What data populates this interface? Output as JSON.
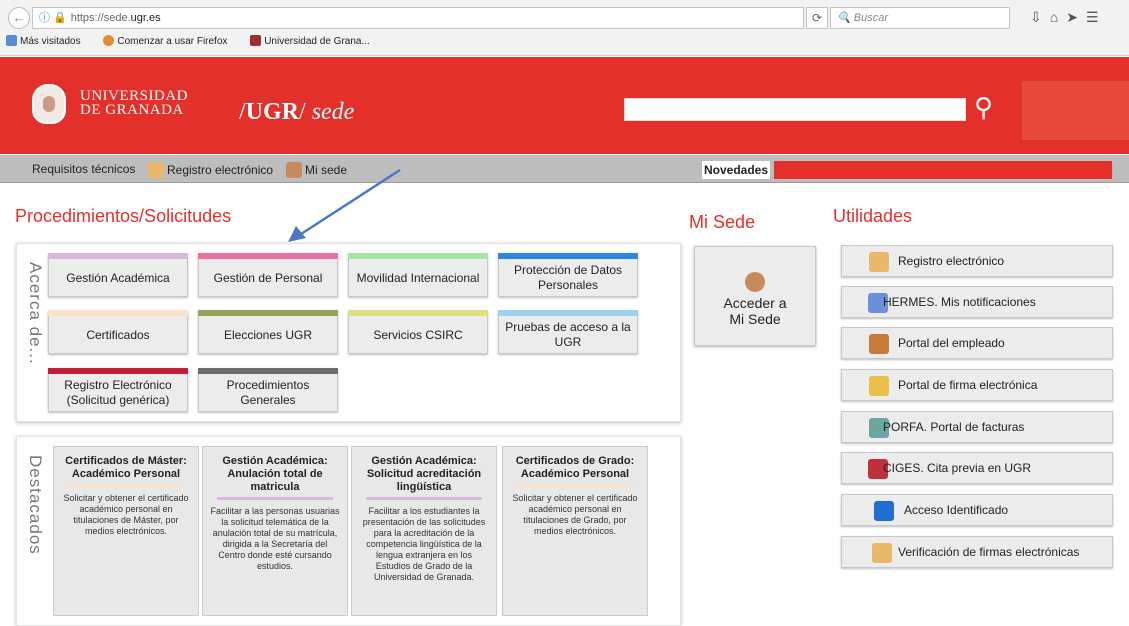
{
  "browser": {
    "url_prefix": "https://sede.",
    "url_domain": "ugr.es",
    "search_placeholder": "Buscar",
    "bookmarks": [
      "Más visitados",
      "Comenzar a usar Firefox",
      "Universidad de Grana..."
    ]
  },
  "header": {
    "logo_line1": "UNIVERSIDAD",
    "logo_line2": "DE GRANADA",
    "title_slash1": "/",
    "title_ugr": "UGR",
    "title_slash2": "/",
    "title_sede": "sede"
  },
  "subnav": {
    "req": "Requisitos técnicos",
    "registro": "Registro electrónico",
    "misede": "Mi sede",
    "novedades": "Novedades"
  },
  "sections": {
    "procedimientos": "Procedimientos/Solicitudes",
    "misede": "Mi Sede",
    "utilidades": "Utilidades",
    "acerca": "Acerca de...",
    "destacados": "Destacados"
  },
  "tiles": [
    {
      "label": "Gestión Académica",
      "color": "#d9b8e0"
    },
    {
      "label": "Gestión de Personal",
      "color": "#ee6fa6"
    },
    {
      "label": "Movilidad Internacional",
      "color": "#a7e3a2"
    },
    {
      "label": "Protección de Datos Personales",
      "color": "#2a86e0"
    },
    {
      "label": "Certificados",
      "color": "#f8e2cc"
    },
    {
      "label": "Elecciones UGR",
      "color": "#97a25f"
    },
    {
      "label": "Servicios CSIRC",
      "color": "#dfe07d"
    },
    {
      "label": "Pruebas de acceso a la UGR",
      "color": "#9fd0ea"
    },
    {
      "label": "Registro Electrónico (Solicitud genérica)",
      "color": "#c02138"
    },
    {
      "label": "Procedimientos Generales",
      "color": "#6d6d6d"
    }
  ],
  "cards": [
    {
      "title": "Certificados de Máster: Académico Personal",
      "desc": "Solicitar y obtener el certificado académico personal en titulaciones de Máster, por medios electrónicos.",
      "color": "#f8e2cc"
    },
    {
      "title": "Gestión Académica: Anulación total de matricula",
      "desc": "Facilitar a las personas usuarias la solicitud telemática de la anulación total de su matrícula, dirigida a la Secretaría del Centro donde esté cursando estudios.",
      "color": "#d9b8e0"
    },
    {
      "title": "Gestión Académica: Solicitud acreditación lingüística",
      "desc": "Facilitar a los estudiantes la presentación de las solicitudes para la acreditación de la competencia lingüística de la lengua extranjera en los Estudios de Grado de la Universidad de Granada.",
      "color": "#d9b8e0"
    },
    {
      "title": "Certificados de Grado: Académico Personal",
      "desc": "Solicitar y obtener el certificado académico personal en titulaciones de Grado, por medios electrónicos.",
      "color": "#f8e2cc"
    }
  ],
  "misede_button": {
    "line1": "Acceder a",
    "line2": "Mi Sede"
  },
  "utilidades": [
    {
      "label": "Registro electrónico",
      "icon": "registro-icon",
      "color": "#e9b86a"
    },
    {
      "label": "HERMES. Mis notificaciones",
      "icon": "mail-icon",
      "color": "#6b8fd8"
    },
    {
      "label": "Portal del empleado",
      "icon": "people-icon",
      "color": "#c97a3a"
    },
    {
      "label": "Portal de firma electrónica",
      "icon": "pen-icon",
      "color": "#e8c04a"
    },
    {
      "label": "PORFA. Portal de facturas",
      "icon": "key-icon",
      "color": "#6aa7a0"
    },
    {
      "label": "CIGES. Cita previa en UGR",
      "icon": "ciges-icon",
      "color": "#c0303a"
    },
    {
      "label": "Acceso Identificado",
      "icon": "lock-icon",
      "color": "#1f6fd0"
    },
    {
      "label": "Verificación de firmas electrónicas",
      "icon": "document-icon",
      "color": "#e9b86a"
    }
  ]
}
